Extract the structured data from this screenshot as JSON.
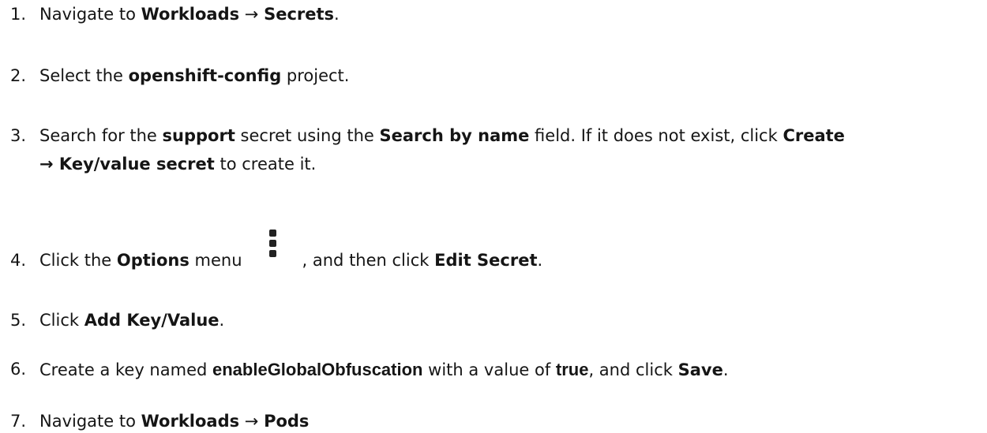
{
  "steps": [
    {
      "num": "1.",
      "t1": "Navigate to ",
      "b1": "Workloads",
      "t2": " → ",
      "b2": "Secrets",
      "t3": "."
    },
    {
      "num": "2.",
      "t1": "Select the ",
      "b1": "openshift-config",
      "t2": " project."
    },
    {
      "num": "3.",
      "t1": "Search for the ",
      "b1": "support",
      "t2": " secret using the ",
      "b2": "Search by name",
      "t3": " field. If it does not exist, click ",
      "b3": "Create",
      "line2_arrow": "→ ",
      "line2_b": "Key/value secret",
      "line2_t": " to create it."
    },
    {
      "num": "4.",
      "t1": "Click the ",
      "b1": "Options",
      "t2": " menu",
      "t3": ", and then click ",
      "b2": "Edit Secret",
      "t4": ".",
      "icon": "kebab-options-icon"
    },
    {
      "num": "5.",
      "t1": "Click ",
      "b1": "Add Key/Value",
      "t2": "."
    },
    {
      "num": "6.",
      "t1": "Create a key named ",
      "b1": "enableGlobalObfuscation",
      "t2": " with a value of ",
      "b2": "true",
      "t3": ", and click ",
      "b3": "Save",
      "t4": "."
    },
    {
      "num": "7.",
      "t1": "Navigate to ",
      "b1": "Workloads",
      "t2": " → ",
      "b2": "Pods"
    }
  ]
}
